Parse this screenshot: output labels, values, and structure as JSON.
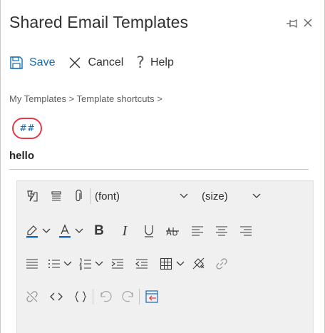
{
  "window": {
    "title": "Shared Email Templates"
  },
  "toolbar": {
    "save_label": "Save",
    "cancel_label": "Cancel",
    "help_label": "Help"
  },
  "breadcrumb": "My Templates > Template shortcuts >",
  "template": {
    "shortcut": "##",
    "name": "hello"
  },
  "editor": {
    "font_select": "(font)",
    "size_select": "(size)",
    "bold_glyph": "B",
    "italic_glyph": "I",
    "icons": [
      "insert-field-icon",
      "paragraph-icon",
      "attach-icon",
      "font-select",
      "size-select",
      "highlight-color-icon",
      "font-color-icon",
      "bold-icon",
      "italic-icon",
      "underline-icon",
      "strikethrough-icon",
      "align-left-icon",
      "align-center-icon",
      "align-right-icon",
      "justify-icon",
      "bullet-list-icon",
      "numbered-list-icon",
      "decrease-indent-icon",
      "increase-indent-icon",
      "table-icon",
      "clear-format-icon",
      "insert-link-icon",
      "remove-link-icon",
      "code-view-icon",
      "braces-icon",
      "undo-icon",
      "redo-icon",
      "fullscreen-icon"
    ],
    "accent_color": "#0f6cbd",
    "highlight_color": "#0f6cbd",
    "shortcut_ring_color": "#e2384a"
  }
}
